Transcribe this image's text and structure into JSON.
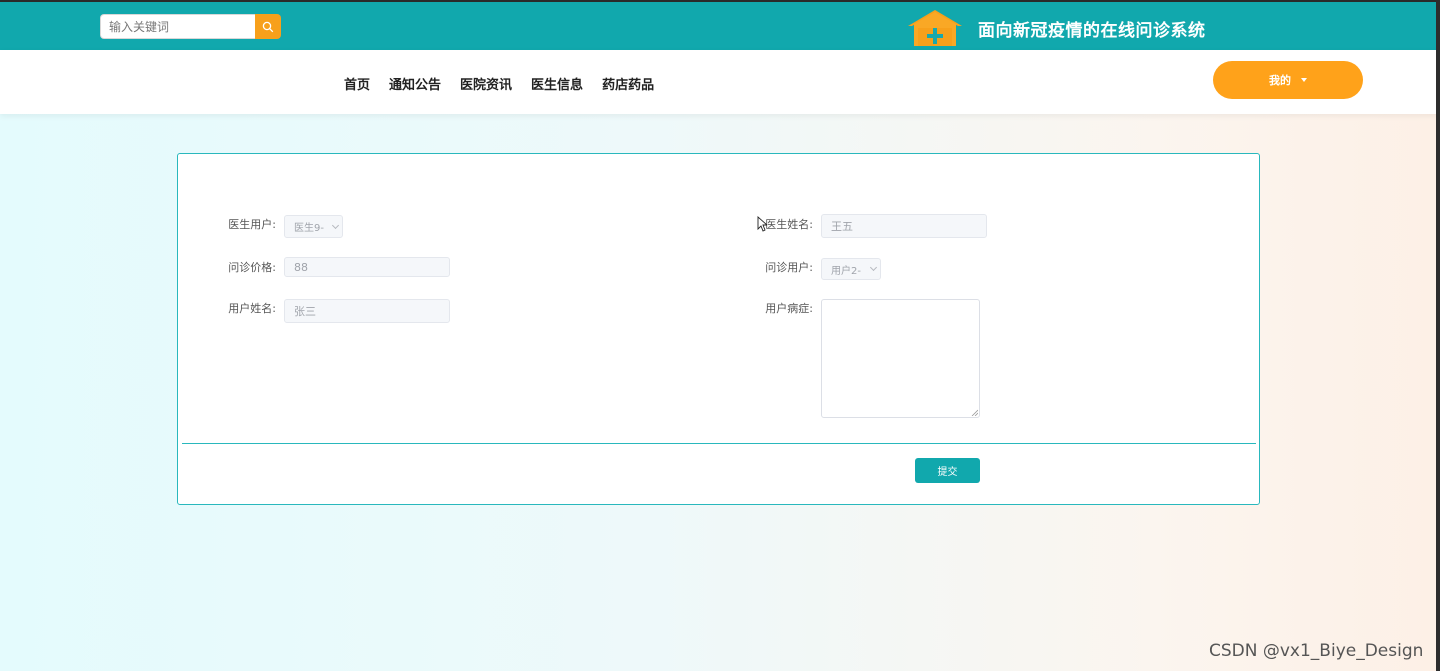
{
  "header": {
    "search_placeholder": "输入关键词",
    "site_title": "面向新冠疫情的在线问诊系统",
    "icons": {
      "search": "search-icon",
      "logo": "house-plus-logo-icon"
    }
  },
  "nav": {
    "items": [
      {
        "label": "首页"
      },
      {
        "label": "通知公告"
      },
      {
        "label": "医院资讯"
      },
      {
        "label": "医生信息"
      },
      {
        "label": "药店药品"
      }
    ],
    "me_label": "我的"
  },
  "form": {
    "doctor_user": {
      "label": "医生用户:",
      "value": "医生9-"
    },
    "doctor_name": {
      "label": "医生姓名:",
      "value": "王五"
    },
    "price": {
      "label": "问诊价格:",
      "value": "88"
    },
    "patient_user": {
      "label": "问诊用户:",
      "value": "用户2-"
    },
    "patient_name": {
      "label": "用户姓名:",
      "value": "张三"
    },
    "symptoms": {
      "label": "用户病症:",
      "value": ""
    },
    "submit_label": "提交"
  },
  "watermark": "CSDN @vx1_Biye_Design",
  "colors": {
    "primary": "#11a8ad",
    "accent": "#ffa21a"
  }
}
